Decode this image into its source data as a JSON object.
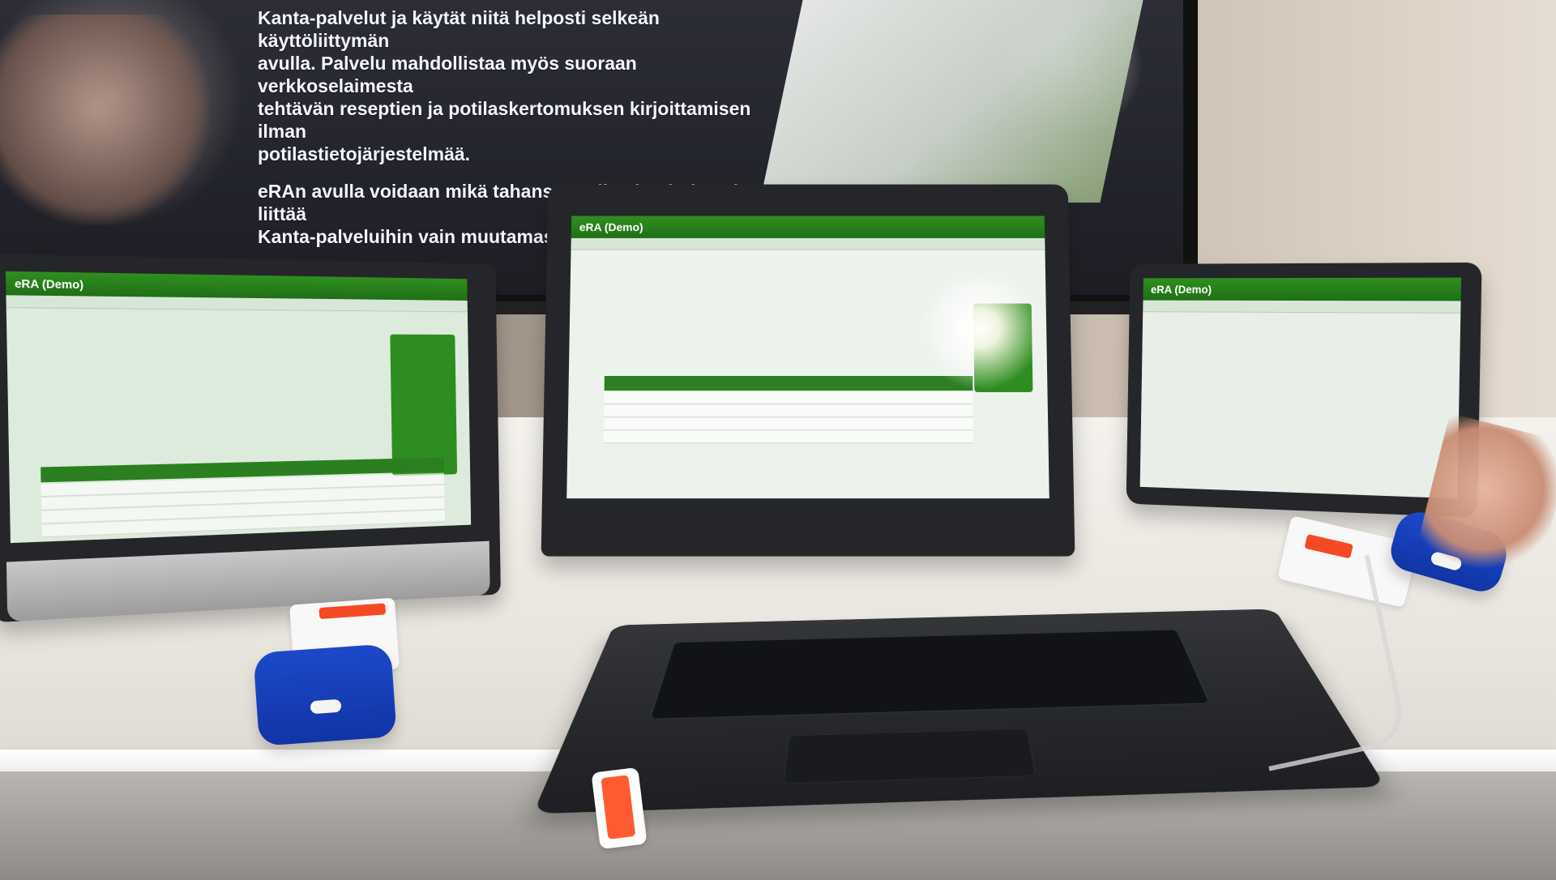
{
  "tv_text": {
    "line_1": "Kanta-palvelut ja käytät niitä helposti selkeän käyttöliittymän",
    "line_2": "avulla. Palvelu mahdollistaa myös suoraan verkkoselaimesta",
    "line_3": "tehtävän reseptien ja potilaskertomuksen kirjoittamisen ilman",
    "line_4": "potilastietojärjestelmää.",
    "line_5": "eRAn avulla voidaan mikä tahansa potilastietojärjestelmä liittää",
    "line_6": "Kanta-palveluihin vain muutamassa työpäivässä."
  },
  "left_tablet": {
    "app_title": "eRA (Demo)"
  },
  "laptop": {
    "app_title": "eRA (Demo)"
  },
  "right_tablet": {
    "app_title": "eRA (Demo)"
  }
}
